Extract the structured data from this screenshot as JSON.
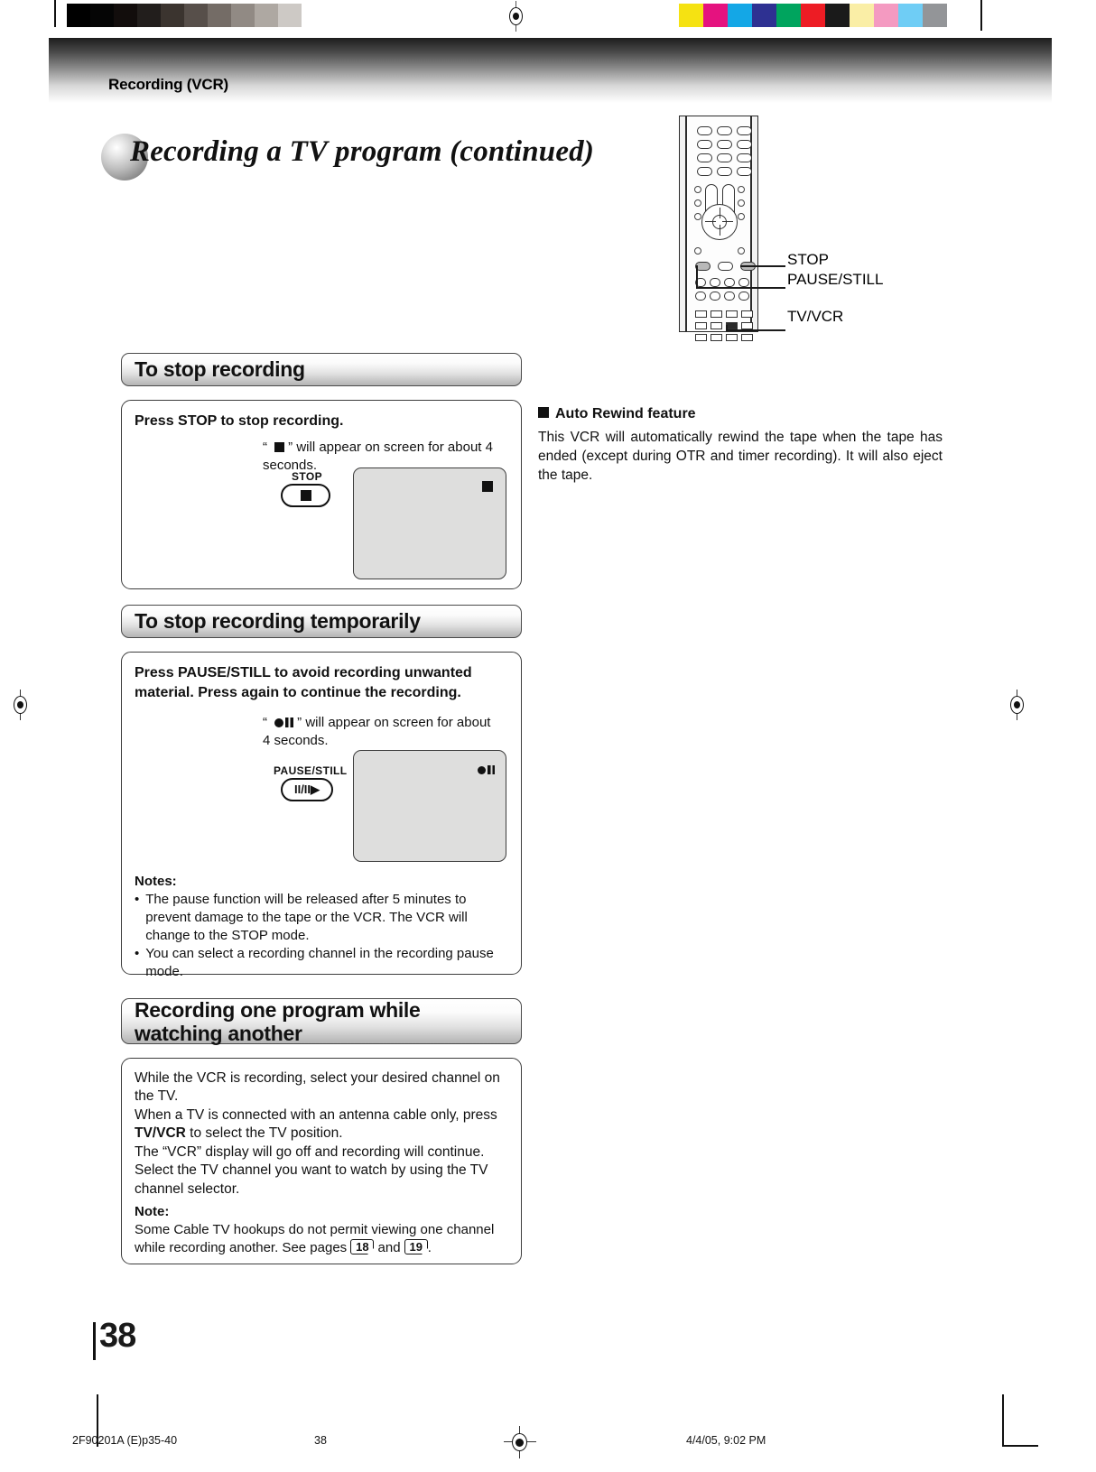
{
  "document": {
    "running_head": "Recording (VCR)",
    "page_title": "Recording a TV program (continued)",
    "page_number": "38"
  },
  "remote_callouts": [
    {
      "label": "STOP"
    },
    {
      "label": "PAUSE/STILL"
    },
    {
      "label": "TV/VCR"
    }
  ],
  "sections": [
    {
      "heading": "To stop recording",
      "instruction": "Press STOP to stop recording.",
      "caption_prefix": "“",
      "caption_suffix": "” will appear on screen for about 4 seconds.",
      "key_label": "STOP",
      "key_glyph": "stop-square-icon",
      "screen_glyph": "stop-square-icon"
    },
    {
      "heading": "To stop recording temporarily",
      "instruction": "Press PAUSE/STILL to avoid recording unwanted material. Press again to continue the recording.",
      "caption_prefix": "“",
      "caption_suffix": "” will appear on screen for about 4 seconds.",
      "key_label": "PAUSE/STILL",
      "key_glyph": "pause-still-icon",
      "key_glyph_text": "II/II▶",
      "screen_glyph": "record-pause-icon",
      "notes_heading": "Notes:",
      "notes": [
        "The pause function will be released after 5 minutes to prevent damage to the tape or the VCR. The VCR will change to the STOP mode.",
        "You can select a recording channel in the recording pause mode."
      ]
    },
    {
      "heading_line1": "Recording one program while",
      "heading_line2": "watching another",
      "body_lines": [
        "While the VCR is recording, select your desired channel on the TV.",
        "When a TV is connected with an antenna cable only, press TV/VCR to select the TV position.",
        "The “VCR” display will go off and recording will continue.",
        "Select the TV channel you want to watch by using the TV channel selector."
      ],
      "body_bold_token": "TV/VCR",
      "note_heading": "Note:",
      "note_text_before": "Some Cable TV hookups do not permit viewing one channel while recording another. See pages",
      "note_page_ref_1": "18",
      "note_conjunction": "and",
      "note_page_ref_2": "19",
      "note_text_after": "."
    }
  ],
  "sidebar": {
    "heading": "Auto Rewind feature",
    "body": "This VCR will automatically rewind the tape when the tape has ended (except during OTR and timer recording). It will also eject the tape."
  },
  "footer": {
    "job_id": "2F90201A (E)p35-40",
    "page": "38",
    "timestamp": "4/4/05, 9:02 PM"
  },
  "registration": {
    "grayscale_swatches": [
      "#000000",
      "#050505",
      "#120d0c",
      "#221e1c",
      "#3b342f",
      "#574f4a",
      "#746c66",
      "#918a84",
      "#aea8a2",
      "#cdc9c5",
      "#ffffff"
    ],
    "color_swatches": [
      "#f5e212",
      "#e5127f",
      "#14a7e6",
      "#2e3192",
      "#00a45e",
      "#ed1c24",
      "#1a1a1a",
      "#faeea6",
      "#f49ac1",
      "#6fcdf5",
      "#939598"
    ]
  }
}
